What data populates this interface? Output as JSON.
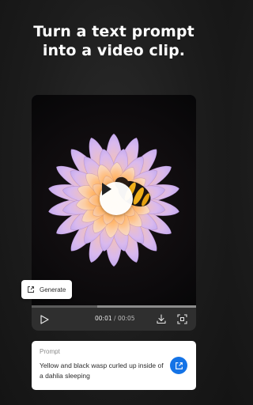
{
  "headline": {
    "line1": "Turn a text prompt",
    "line2": "into a video clip."
  },
  "player": {
    "current_time": "00:01",
    "separator": "/",
    "duration": "00:05",
    "progress_fraction": 0.4,
    "play_icon": "play-icon",
    "download_icon": "download-icon",
    "fullscreen_icon": "fullscreen-icon"
  },
  "generate_chip": {
    "label": "Generate",
    "icon": "share-out-icon"
  },
  "prompt": {
    "title": "Prompt",
    "text": "Yellow and black wasp curled up inside of a dahlia sleeping",
    "button_icon": "share-out-icon"
  },
  "colors": {
    "accent": "#1473e6",
    "background": "#1c1c1c",
    "controls_bar": "#2f2f2f"
  }
}
